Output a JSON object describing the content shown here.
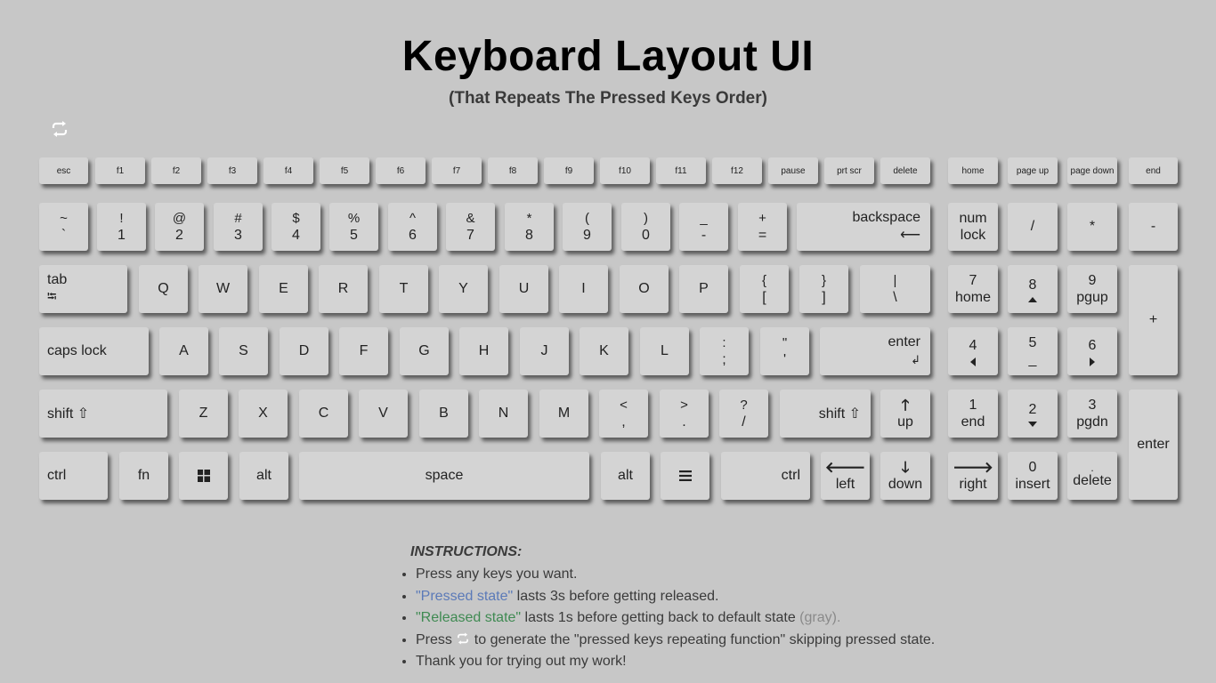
{
  "title": "Keyboard Layout UI",
  "subtitle": "(That Repeats The Pressed Keys Order)",
  "repeat_button_icon": "repeat-icon",
  "function_row": {
    "esc": "esc",
    "f1": "f1",
    "f2": "f2",
    "f3": "f3",
    "f4": "f4",
    "f5": "f5",
    "f6": "f6",
    "f7": "f7",
    "f8": "f8",
    "f9": "f9",
    "f10": "f10",
    "f11": "f11",
    "f12": "f12",
    "pause": "pause",
    "prtscr": "prt scr",
    "delete": "delete",
    "home": "home",
    "pageup": "page up",
    "pagedown": "page down",
    "end": "end"
  },
  "number_row": {
    "backtick": {
      "top": "~",
      "bottom": "`"
    },
    "n1": {
      "top": "!",
      "bottom": "1"
    },
    "n2": {
      "top": "@",
      "bottom": "2"
    },
    "n3": {
      "top": "#",
      "bottom": "3"
    },
    "n4": {
      "top": "$",
      "bottom": "4"
    },
    "n5": {
      "top": "%",
      "bottom": "5"
    },
    "n6": {
      "top": "^",
      "bottom": "6"
    },
    "n7": {
      "top": "&",
      "bottom": "7"
    },
    "n8": {
      "top": "*",
      "bottom": "8"
    },
    "n9": {
      "top": "(",
      "bottom": "9"
    },
    "n0": {
      "top": ")",
      "bottom": "0"
    },
    "minus": {
      "top": "_",
      "bottom": "-"
    },
    "equal": {
      "top": "+",
      "bottom": "="
    },
    "backspace": {
      "label": "backspace",
      "symbol": "⟵"
    }
  },
  "top_row": {
    "tab": {
      "label": "tab",
      "symbol": "⭾"
    },
    "q": "Q",
    "w": "W",
    "e": "E",
    "r": "R",
    "t": "T",
    "y": "Y",
    "u": "U",
    "i": "I",
    "o": "O",
    "p": "P",
    "lbracket": {
      "top": "{",
      "bottom": "["
    },
    "rbracket": {
      "top": "}",
      "bottom": "]"
    },
    "backslash": {
      "top": "|",
      "bottom": "\\"
    }
  },
  "home_row": {
    "capslock": "caps lock",
    "a": "A",
    "s": "S",
    "d": "D",
    "f": "F",
    "g": "G",
    "h": "H",
    "j": "J",
    "k": "K",
    "l": "L",
    "semicolon": {
      "top": ":",
      "bottom": ";"
    },
    "quote": {
      "top": "\"",
      "bottom": "'"
    },
    "enter": {
      "label": "enter",
      "symbol": "↲"
    }
  },
  "bottom_row": {
    "lshift": "shift ⇧",
    "z": "Z",
    "x": "X",
    "c": "C",
    "v": "V",
    "b": "B",
    "n": "N",
    "m": "M",
    "comma": {
      "top": "<",
      "bottom": ","
    },
    "period": {
      "top": ">",
      "bottom": "."
    },
    "slash": {
      "top": "?",
      "bottom": "/"
    },
    "rshift": "shift ⇧",
    "up": {
      "symbol": "🡑",
      "label": "up"
    }
  },
  "space_row": {
    "lctrl": "ctrl",
    "fn": "fn",
    "windows_icon": "windows-icon",
    "lalt": "alt",
    "space": "space",
    "ralt": "alt",
    "menu_icon": "menu-icon",
    "rctrl": "ctrl",
    "left": {
      "symbol": "🡐",
      "label": "left"
    },
    "down": {
      "symbol": "🡓",
      "label": "down"
    }
  },
  "numpad": {
    "numlock": {
      "top": "num",
      "bottom": "lock"
    },
    "divide": "/",
    "multiply": "*",
    "subtract": "-",
    "n7": {
      "top": "7",
      "bottom": "home"
    },
    "n8": {
      "top": "8"
    },
    "n9": {
      "top": "9",
      "bottom": "pgup"
    },
    "add": "+",
    "n4": {
      "top": "4"
    },
    "n5": {
      "top": "5",
      "bottom": "_"
    },
    "n6": {
      "top": "6"
    },
    "n1": {
      "top": "1",
      "bottom": "end"
    },
    "n2": {
      "top": "2"
    },
    "n3": {
      "top": "3",
      "bottom": "pgdn"
    },
    "enter": "enter",
    "right": {
      "symbol": "🡒",
      "label": "right"
    },
    "n0": {
      "top": "0",
      "bottom": "insert"
    },
    "decimal": {
      "top": ".",
      "bottom": "delete"
    }
  },
  "instructions": {
    "heading": "INSTRUCTIONS:",
    "item1": "Press any keys you want.",
    "item2_highlight": "\"Pressed state\"",
    "item2_rest": " lasts 3s before getting released.",
    "item3_highlight": "\"Released state\"",
    "item3_rest": " lasts 1s before getting back to default state ",
    "item3_gray": "(gray).",
    "item4_before": "Press ",
    "item4_after": " to generate the \"pressed keys repeating function\" skipping pressed state.",
    "item5": "Thank you for trying out my work!"
  },
  "colors": {
    "background": "#c7c7c7",
    "key": "#d4d4d4",
    "pressed_text": "#5b7ab8",
    "released_text": "#3f8a52",
    "default_text": "#8a8a8a"
  }
}
